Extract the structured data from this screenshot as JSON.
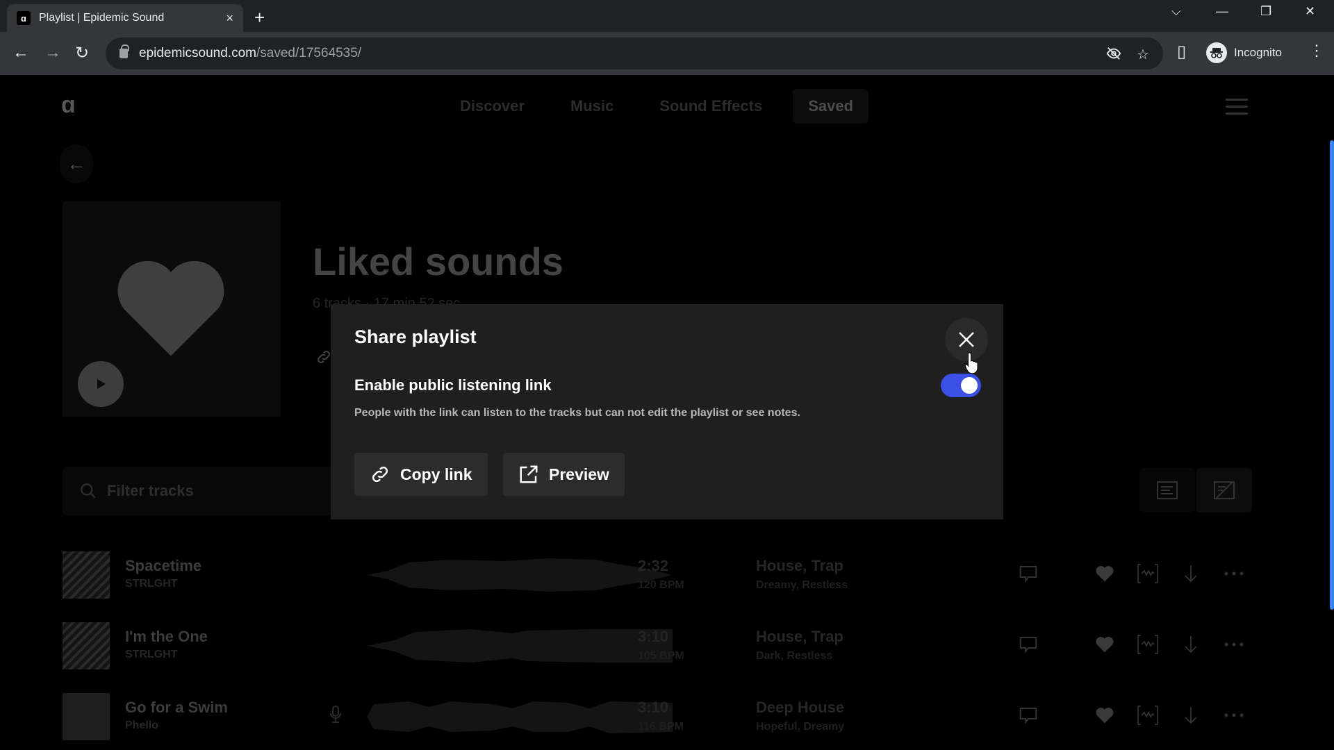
{
  "browser": {
    "tab_title": "Playlist | Epidemic Sound",
    "tab_favicon": "epidemic-logo-icon",
    "url_host": "epidemicsound.com",
    "url_path": "/saved/17564535/",
    "profile_label": "Incognito",
    "icons": {
      "close_tab": "×",
      "new_tab": "+",
      "tab_search": "⌵",
      "minimize": "—",
      "restore": "❐",
      "close_window": "✕",
      "back": "←",
      "forward": "→",
      "reload": "↻",
      "eye_off": "eye-off-icon",
      "star": "☆",
      "side_panel": "▯",
      "menu": "⋮"
    }
  },
  "site": {
    "logo_glyph": "ɑ",
    "nav": [
      {
        "label": "Discover",
        "active": false
      },
      {
        "label": "Music",
        "active": false
      },
      {
        "label": "Sound Effects",
        "active": false
      },
      {
        "label": "Saved",
        "active": true
      }
    ],
    "back_glyph": "←"
  },
  "playlist": {
    "title": "Liked sounds",
    "meta": "6 tracks · 17 min 52 sec",
    "link_glyph": "🔗"
  },
  "filter": {
    "placeholder": "Filter tracks",
    "search_glyph": "⚲"
  },
  "tracks": [
    {
      "title": "Spacetime",
      "artist": "STRLGHT",
      "duration": "2:32",
      "bpm": "120 BPM",
      "genres": "House, Trap",
      "moods": "Dreamy, Restless",
      "has_vocals": false,
      "liked": true
    },
    {
      "title": "I'm the One",
      "artist": "STRLGHT",
      "duration": "3:10",
      "bpm": "105 BPM",
      "genres": "House, Trap",
      "moods": "Dark, Restless",
      "has_vocals": false,
      "liked": true
    },
    {
      "title": "Go for a Swim",
      "artist": "Phello",
      "duration": "3:10",
      "bpm": "116 BPM",
      "genres": "Deep House",
      "moods": "Hopeful, Dreamy",
      "has_vocals": true,
      "liked": true
    }
  ],
  "modal": {
    "title": "Share playlist",
    "option_label": "Enable public listening link",
    "option_description": "People with the link can listen to the tracks but can not edit the playlist or see notes.",
    "toggle_on": true,
    "copy_link_label": "Copy link",
    "preview_label": "Preview"
  },
  "colors": {
    "toggle_on": "#3b4fe4",
    "modal_bg": "#1f1f1f",
    "scrollbar": "#3b82f6"
  }
}
